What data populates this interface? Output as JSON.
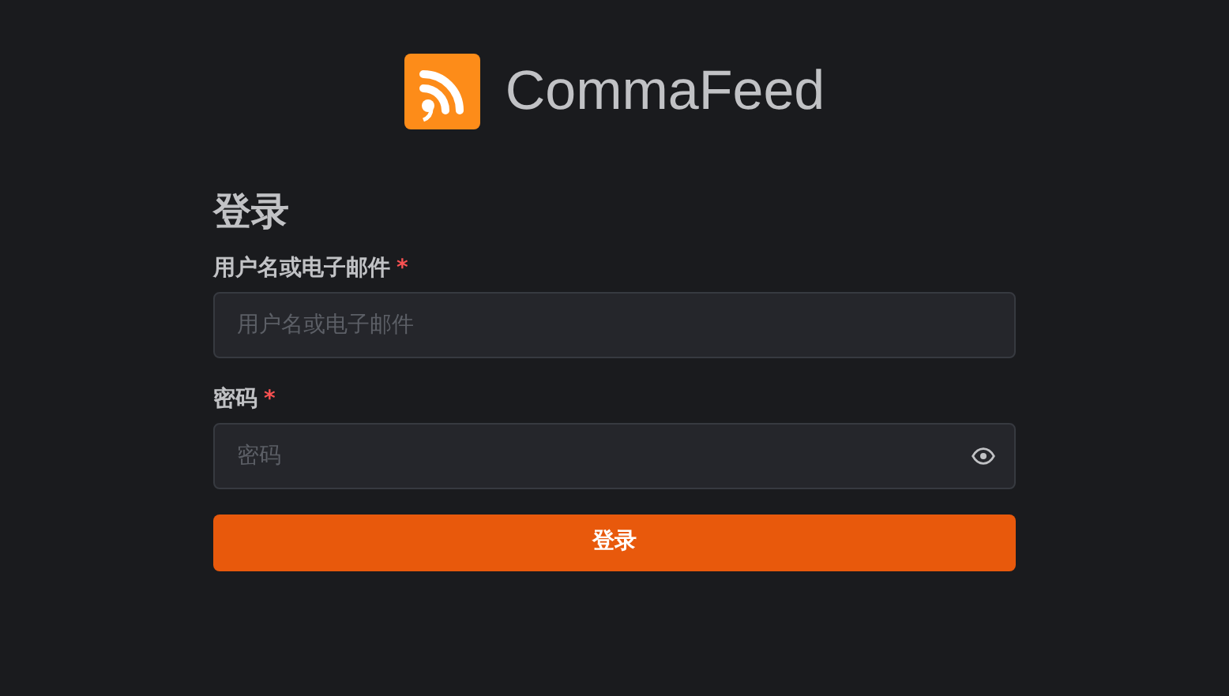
{
  "brand": {
    "name": "CommaFeed"
  },
  "title": "登录",
  "fields": [
    {
      "kind": "text",
      "label": "用户名或电子邮件",
      "required_mark": "*",
      "placeholder": "用户名或电子邮件"
    },
    {
      "kind": "password",
      "label": "密码",
      "required_mark": "*",
      "placeholder": "密码"
    }
  ],
  "submit": "登录"
}
